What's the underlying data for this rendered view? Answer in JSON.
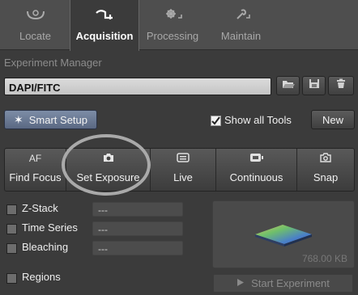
{
  "tabs": [
    {
      "label": "Locate",
      "icon": "locate-icon",
      "active": false
    },
    {
      "label": "Acquisition",
      "icon": "acquisition-icon",
      "active": true
    },
    {
      "label": "Processing",
      "icon": "processing-icon",
      "active": false
    },
    {
      "label": "Maintain",
      "icon": "maintain-icon",
      "active": false
    }
  ],
  "experiment": {
    "section_label": "Experiment Manager",
    "name": "DAPI/FITC",
    "icons": [
      "open-folder-icon",
      "save-icon",
      "delete-icon"
    ]
  },
  "toolbar": {
    "smart_setup": "Smart Setup",
    "show_all_tools": "Show all Tools",
    "show_all_checked": true,
    "new_label": "New"
  },
  "actions": [
    {
      "icon_text": "AF",
      "label": "Find Focus"
    },
    {
      "icon": "camera-icon",
      "label": "Set Exposure",
      "highlighted": true
    },
    {
      "icon": "live-icon",
      "label": "Live"
    },
    {
      "icon": "continuous-icon",
      "label": "Continuous"
    },
    {
      "icon": "snap-icon",
      "label": "Snap"
    }
  ],
  "options": [
    {
      "label": "Z-Stack",
      "value": "---"
    },
    {
      "label": "Time Series",
      "value": "---"
    },
    {
      "label": "Bleaching",
      "value": "---"
    },
    {
      "label": "Regions",
      "value": ""
    }
  ],
  "preview": {
    "size": "768.00 KB"
  },
  "start_label": "Start Experiment",
  "colors": {
    "accent": "#6f7f9a",
    "background": "#3b3b3b",
    "tabbar": "#4e4e4e"
  }
}
